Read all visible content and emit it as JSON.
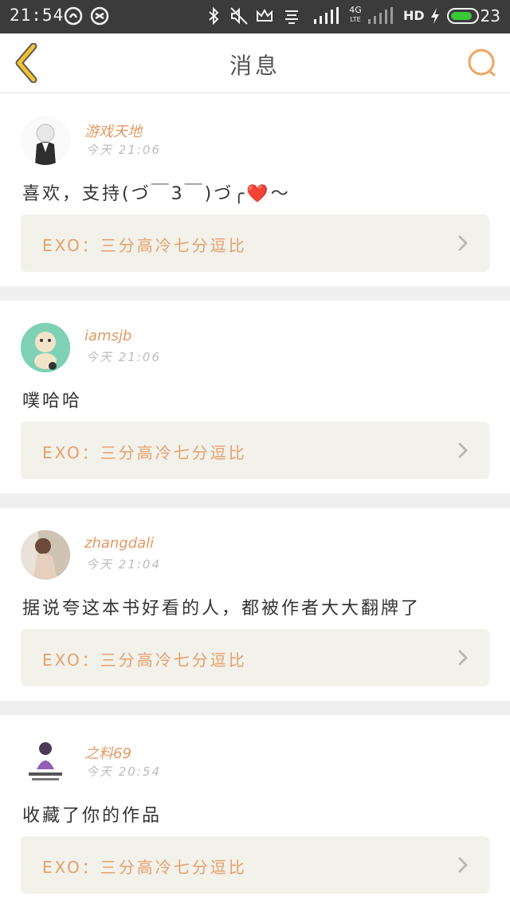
{
  "status_bar": {
    "time": "21:54",
    "battery_level": "23",
    "network_badge_4g": "4G",
    "network_badge_lte": "LTE",
    "hd_badge": "HD"
  },
  "header": {
    "title": "消息",
    "back_icon": "chevron-left-icon",
    "search_icon": "search-icon"
  },
  "colors": {
    "accent": "#e6a06d",
    "username": "#e19a62",
    "back_arrow": "#f2c12e"
  },
  "messages": [
    {
      "username": "游戏天地",
      "time": "今天 21:06",
      "text": "喜欢，支持(づ￣3￣)づ╭❤️～",
      "book": "EXO：三分高冷七分逗比"
    },
    {
      "username": "iamsjb",
      "time": "今天 21:06",
      "text": "噗哈哈",
      "book": "EXO：三分高冷七分逗比"
    },
    {
      "username": "zhangdali",
      "time": "今天 21:04",
      "text": "据说夸这本书好看的人，都被作者大大翻牌了",
      "book": "EXO：三分高冷七分逗比"
    },
    {
      "username": "之料69",
      "time": "今天 20:54",
      "text": "收藏了你的作品",
      "book": "EXO：三分高冷七分逗比"
    }
  ]
}
